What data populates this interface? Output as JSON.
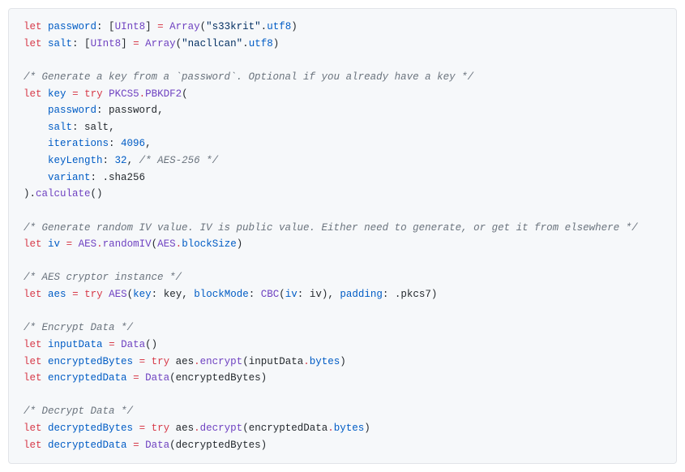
{
  "code": {
    "l1": {
      "kw1": "let",
      "id1": "password",
      "punc1": ": [",
      "type1": "UInt8",
      "punc2": "] ",
      "op1": "=",
      "space1": " ",
      "fn1": "Array",
      "punc3": "(",
      "str1": "\"s33krit\"",
      "punc4": ".",
      "id2": "utf8",
      "punc5": ")"
    },
    "l2": {
      "kw1": "let",
      "id1": "salt",
      "punc1": ": [",
      "type1": "UInt8",
      "punc2": "] ",
      "op1": "=",
      "space1": " ",
      "fn1": "Array",
      "punc3": "(",
      "str1": "\"nacllcan\"",
      "punc4": ".",
      "id2": "utf8",
      "punc5": ")"
    },
    "c1": "/* Generate a key from a `password`. Optional if you already have a key */",
    "l4a": {
      "kw1": "let",
      "id1": "key",
      "op1": "=",
      "kw2": "try",
      "type1": "PKCS5",
      "punc1": ".",
      "fn1": "PBKDF2",
      "punc2": "("
    },
    "l4b": {
      "id1": "password",
      "punc1": ": ",
      "id2": "password",
      "punc2": ","
    },
    "l4c": {
      "id1": "salt",
      "punc1": ": ",
      "id2": "salt",
      "punc2": ","
    },
    "l4d": {
      "id1": "iterations",
      "punc1": ": ",
      "num1": "4096",
      "punc2": ","
    },
    "l4e": {
      "id1": "keyLength",
      "punc1": ": ",
      "num1": "32",
      "punc2": ", ",
      "comment": "/* AES-256 */"
    },
    "l4f": {
      "id1": "variant",
      "punc1": ": .",
      "id2": "sha256"
    },
    "l4g": {
      "punc1": ").",
      "fn1": "calculate",
      "punc2": "()"
    },
    "c2": "/* Generate random IV value. IV is public value. Either need to generate, or get it from elsewhere */",
    "l6": {
      "kw1": "let",
      "id1": "iv",
      "op1": "=",
      "type1": "AES",
      "punc1": ".",
      "fn1": "randomIV",
      "punc2": "(",
      "type2": "AES",
      "punc3": ".",
      "id2": "blockSize",
      "punc4": ")"
    },
    "c3": "/* AES cryptor instance */",
    "l8": {
      "kw1": "let",
      "id1": "aes",
      "op1": "=",
      "kw2": "try",
      "fn1": "AES",
      "punc1": "(",
      "id2": "key",
      "punc2": ": ",
      "id3": "key",
      "punc3": ", ",
      "id4": "blockMode",
      "punc4": ": ",
      "fn2": "CBC",
      "punc5": "(",
      "id5": "iv",
      "punc6": ": ",
      "id6": "iv",
      "punc7": "), ",
      "id7": "padding",
      "punc8": ": .",
      "id8": "pkcs7",
      "punc9": ")"
    },
    "c4": "/* Encrypt Data */",
    "l10": {
      "kw1": "let",
      "id1": "inputData",
      "op1": "=",
      "fn1": "Data",
      "punc1": "()"
    },
    "l11": {
      "kw1": "let",
      "id1": "encryptedBytes",
      "op1": "=",
      "kw2": "try",
      "id2": "aes",
      "punc1": ".",
      "fn1": "encrypt",
      "punc2": "(",
      "id3": "inputData",
      "punc3": ".",
      "id4": "bytes",
      "punc4": ")"
    },
    "l12": {
      "kw1": "let",
      "id1": "encryptedData",
      "op1": "=",
      "fn1": "Data",
      "punc1": "(",
      "id2": "encryptedBytes",
      "punc2": ")"
    },
    "c5": "/* Decrypt Data */",
    "l14": {
      "kw1": "let",
      "id1": "decryptedBytes",
      "op1": "=",
      "kw2": "try",
      "id2": "aes",
      "punc1": ".",
      "fn1": "decrypt",
      "punc2": "(",
      "id3": "encryptedData",
      "punc3": ".",
      "id4": "bytes",
      "punc4": ")"
    },
    "l15": {
      "kw1": "let",
      "id1": "decryptedData",
      "op1": "=",
      "fn1": "Data",
      "punc1": "(",
      "id2": "decryptedBytes",
      "punc2": ")"
    }
  }
}
